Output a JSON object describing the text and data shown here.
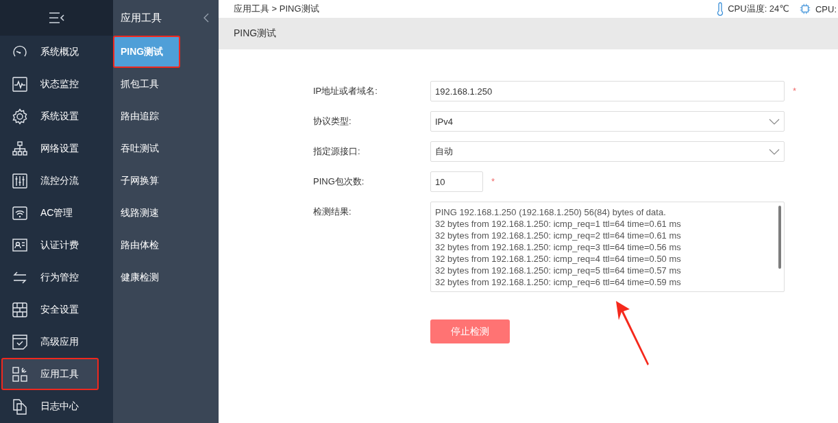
{
  "sidebar": {
    "items": [
      {
        "label": "系统概况",
        "selected": false,
        "annotated": false
      },
      {
        "label": "状态监控",
        "selected": false,
        "annotated": false
      },
      {
        "label": "系统设置",
        "selected": false,
        "annotated": false
      },
      {
        "label": "网络设置",
        "selected": false,
        "annotated": false
      },
      {
        "label": "流控分流",
        "selected": false,
        "annotated": false
      },
      {
        "label": "AC管理",
        "selected": false,
        "annotated": false
      },
      {
        "label": "认证计费",
        "selected": false,
        "annotated": false
      },
      {
        "label": "行为管控",
        "selected": false,
        "annotated": false
      },
      {
        "label": "安全设置",
        "selected": false,
        "annotated": false
      },
      {
        "label": "高级应用",
        "selected": false,
        "annotated": false
      },
      {
        "label": "应用工具",
        "selected": true,
        "annotated": true
      },
      {
        "label": "日志中心",
        "selected": false,
        "annotated": false
      }
    ]
  },
  "submenu": {
    "title": "应用工具",
    "items": [
      {
        "label": "PING测试",
        "selected": true,
        "annotated": true
      },
      {
        "label": "抓包工具",
        "selected": false,
        "annotated": false
      },
      {
        "label": "路由追踪",
        "selected": false,
        "annotated": false
      },
      {
        "label": "吞吐测试",
        "selected": false,
        "annotated": false
      },
      {
        "label": "子网换算",
        "selected": false,
        "annotated": false
      },
      {
        "label": "线路测速",
        "selected": false,
        "annotated": false
      },
      {
        "label": "路由体检",
        "selected": false,
        "annotated": false
      },
      {
        "label": "健康检测",
        "selected": false,
        "annotated": false
      }
    ]
  },
  "breadcrumb": "应用工具 > PING测试",
  "status": [
    {
      "kind": "thermometer",
      "text": "CPU温度: 24℃"
    },
    {
      "kind": "chip",
      "text": "CPU:"
    }
  ],
  "page_title": "PING测试",
  "form": {
    "fields": [
      {
        "kind": "input",
        "label": "IP地址或者域名:",
        "value": "192.168.1.250",
        "asterisk": "*"
      },
      {
        "kind": "select",
        "label": "协议类型:",
        "value": "IPv4"
      },
      {
        "kind": "select",
        "label": "指定源接口:",
        "value": "自动"
      },
      {
        "kind": "number",
        "label": "PING包次数:",
        "value": "10",
        "asterisk": "*"
      },
      {
        "kind": "output",
        "label": "检测结果:",
        "lines": [
          "PING 192.168.1.250 (192.168.1.250) 56(84) bytes of data.",
          "32 bytes from 192.168.1.250: icmp_req=1 ttl=64 time=0.61 ms",
          "32 bytes from 192.168.1.250: icmp_req=2 ttl=64 time=0.61 ms",
          "32 bytes from 192.168.1.250: icmp_req=3 ttl=64 time=0.56 ms",
          "32 bytes from 192.168.1.250: icmp_req=4 ttl=64 time=0.50 ms",
          "32 bytes from 192.168.1.250: icmp_req=5 ttl=64 time=0.57 ms",
          "32 bytes from 192.168.1.250: icmp_req=6 ttl=64 time=0.59 ms"
        ]
      }
    ],
    "button": "停止检测"
  }
}
